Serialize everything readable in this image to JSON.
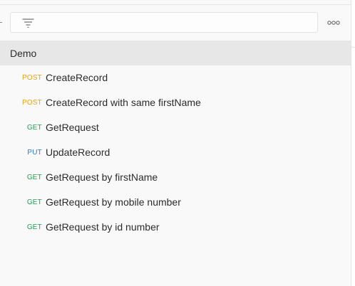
{
  "colors": {
    "post": "#e7a211",
    "get": "#1f9d55",
    "put": "#2a7ad1"
  },
  "toolbar": {
    "filter_icon": "filter-icon",
    "more_icon": "more-options-icon",
    "filter_placeholder": ""
  },
  "collection": {
    "name": "Demo"
  },
  "requests": [
    {
      "method": "POST",
      "method_type": "post",
      "name": "CreateRecord"
    },
    {
      "method": "POST",
      "method_type": "post",
      "name": "CreateRecord with same firstName"
    },
    {
      "method": "GET",
      "method_type": "get",
      "name": "GetRequest"
    },
    {
      "method": "PUT",
      "method_type": "put",
      "name": "UpdateRecord"
    },
    {
      "method": "GET",
      "method_type": "get",
      "name": "GetRequest by firstName"
    },
    {
      "method": "GET",
      "method_type": "get",
      "name": "GetRequest by mobile number"
    },
    {
      "method": "GET",
      "method_type": "get",
      "name": "GetRequest by id number"
    }
  ]
}
